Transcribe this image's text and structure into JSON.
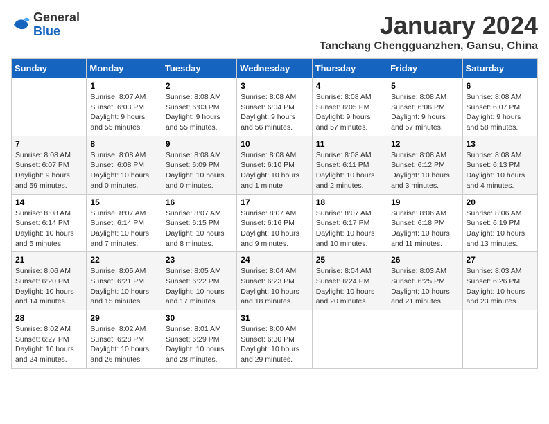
{
  "logo": {
    "general": "General",
    "blue": "Blue"
  },
  "title": "January 2024",
  "location": "Tanchang Chengguanzhen, Gansu, China",
  "days_header": [
    "Sunday",
    "Monday",
    "Tuesday",
    "Wednesday",
    "Thursday",
    "Friday",
    "Saturday"
  ],
  "weeks": [
    [
      {
        "day": "",
        "info": ""
      },
      {
        "day": "1",
        "info": "Sunrise: 8:07 AM\nSunset: 6:03 PM\nDaylight: 9 hours\nand 55 minutes."
      },
      {
        "day": "2",
        "info": "Sunrise: 8:08 AM\nSunset: 6:03 PM\nDaylight: 9 hours\nand 55 minutes."
      },
      {
        "day": "3",
        "info": "Sunrise: 8:08 AM\nSunset: 6:04 PM\nDaylight: 9 hours\nand 56 minutes."
      },
      {
        "day": "4",
        "info": "Sunrise: 8:08 AM\nSunset: 6:05 PM\nDaylight: 9 hours\nand 57 minutes."
      },
      {
        "day": "5",
        "info": "Sunrise: 8:08 AM\nSunset: 6:06 PM\nDaylight: 9 hours\nand 57 minutes."
      },
      {
        "day": "6",
        "info": "Sunrise: 8:08 AM\nSunset: 6:07 PM\nDaylight: 9 hours\nand 58 minutes."
      }
    ],
    [
      {
        "day": "7",
        "info": "Sunrise: 8:08 AM\nSunset: 6:07 PM\nDaylight: 9 hours\nand 59 minutes."
      },
      {
        "day": "8",
        "info": "Sunrise: 8:08 AM\nSunset: 6:08 PM\nDaylight: 10 hours\nand 0 minutes."
      },
      {
        "day": "9",
        "info": "Sunrise: 8:08 AM\nSunset: 6:09 PM\nDaylight: 10 hours\nand 0 minutes."
      },
      {
        "day": "10",
        "info": "Sunrise: 8:08 AM\nSunset: 6:10 PM\nDaylight: 10 hours\nand 1 minute."
      },
      {
        "day": "11",
        "info": "Sunrise: 8:08 AM\nSunset: 6:11 PM\nDaylight: 10 hours\nand 2 minutes."
      },
      {
        "day": "12",
        "info": "Sunrise: 8:08 AM\nSunset: 6:12 PM\nDaylight: 10 hours\nand 3 minutes."
      },
      {
        "day": "13",
        "info": "Sunrise: 8:08 AM\nSunset: 6:13 PM\nDaylight: 10 hours\nand 4 minutes."
      }
    ],
    [
      {
        "day": "14",
        "info": "Sunrise: 8:08 AM\nSunset: 6:14 PM\nDaylight: 10 hours\nand 5 minutes."
      },
      {
        "day": "15",
        "info": "Sunrise: 8:07 AM\nSunset: 6:14 PM\nDaylight: 10 hours\nand 7 minutes."
      },
      {
        "day": "16",
        "info": "Sunrise: 8:07 AM\nSunset: 6:15 PM\nDaylight: 10 hours\nand 8 minutes."
      },
      {
        "day": "17",
        "info": "Sunrise: 8:07 AM\nSunset: 6:16 PM\nDaylight: 10 hours\nand 9 minutes."
      },
      {
        "day": "18",
        "info": "Sunrise: 8:07 AM\nSunset: 6:17 PM\nDaylight: 10 hours\nand 10 minutes."
      },
      {
        "day": "19",
        "info": "Sunrise: 8:06 AM\nSunset: 6:18 PM\nDaylight: 10 hours\nand 11 minutes."
      },
      {
        "day": "20",
        "info": "Sunrise: 8:06 AM\nSunset: 6:19 PM\nDaylight: 10 hours\nand 13 minutes."
      }
    ],
    [
      {
        "day": "21",
        "info": "Sunrise: 8:06 AM\nSunset: 6:20 PM\nDaylight: 10 hours\nand 14 minutes."
      },
      {
        "day": "22",
        "info": "Sunrise: 8:05 AM\nSunset: 6:21 PM\nDaylight: 10 hours\nand 15 minutes."
      },
      {
        "day": "23",
        "info": "Sunrise: 8:05 AM\nSunset: 6:22 PM\nDaylight: 10 hours\nand 17 minutes."
      },
      {
        "day": "24",
        "info": "Sunrise: 8:04 AM\nSunset: 6:23 PM\nDaylight: 10 hours\nand 18 minutes."
      },
      {
        "day": "25",
        "info": "Sunrise: 8:04 AM\nSunset: 6:24 PM\nDaylight: 10 hours\nand 20 minutes."
      },
      {
        "day": "26",
        "info": "Sunrise: 8:03 AM\nSunset: 6:25 PM\nDaylight: 10 hours\nand 21 minutes."
      },
      {
        "day": "27",
        "info": "Sunrise: 8:03 AM\nSunset: 6:26 PM\nDaylight: 10 hours\nand 23 minutes."
      }
    ],
    [
      {
        "day": "28",
        "info": "Sunrise: 8:02 AM\nSunset: 6:27 PM\nDaylight: 10 hours\nand 24 minutes."
      },
      {
        "day": "29",
        "info": "Sunrise: 8:02 AM\nSunset: 6:28 PM\nDaylight: 10 hours\nand 26 minutes."
      },
      {
        "day": "30",
        "info": "Sunrise: 8:01 AM\nSunset: 6:29 PM\nDaylight: 10 hours\nand 28 minutes."
      },
      {
        "day": "31",
        "info": "Sunrise: 8:00 AM\nSunset: 6:30 PM\nDaylight: 10 hours\nand 29 minutes."
      },
      {
        "day": "",
        "info": ""
      },
      {
        "day": "",
        "info": ""
      },
      {
        "day": "",
        "info": ""
      }
    ]
  ]
}
